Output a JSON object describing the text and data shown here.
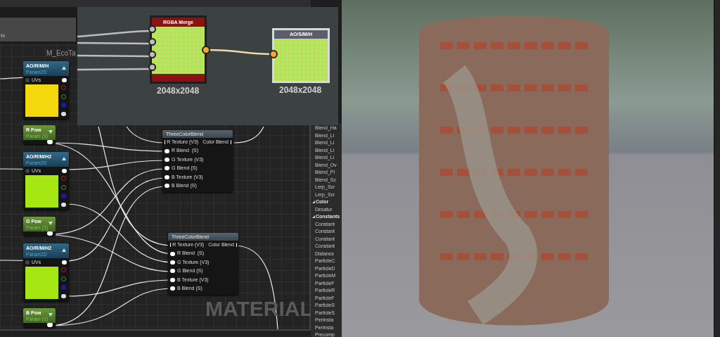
{
  "editor": {
    "tab_label": "ts",
    "material_name": "M_EcoTa",
    "graph_label": "MATERIAL"
  },
  "param_nodes": [
    {
      "kind": "texture",
      "title": "AO/R/M/H",
      "subtitle": "Param2D",
      "input": "UVs",
      "color": "#f2d80c"
    },
    {
      "kind": "scalar",
      "title": "R Pow",
      "subtitle": "Param (1)"
    },
    {
      "kind": "texture",
      "title": "AO/R/M/H2",
      "subtitle": "Param2D",
      "input": "UVs",
      "color": "#a6e612"
    },
    {
      "kind": "scalar",
      "title": "G Pow",
      "subtitle": "Param (1)"
    },
    {
      "kind": "texture",
      "title": "AO/R/M/H2",
      "subtitle": "Param2D",
      "input": "UVs",
      "color": "#a6e612"
    },
    {
      "kind": "scalar",
      "title": "B Pow",
      "subtitle": "Param (1)"
    }
  ],
  "blend_nodes": [
    {
      "title": "ThreeColorBlend",
      "output": "Color Blend",
      "inputs": [
        "R Texture (V3)",
        "R Blend  (S)",
        "G Texture (V3)",
        "G Blend (S)",
        "B Texture (V3)",
        "B Blend (S)"
      ]
    },
    {
      "title": "ThreeColorBlend",
      "output": "Color Blend",
      "inputs": [
        "R Texture (V3)",
        "R Blend  (S)",
        "G Texture (V3)",
        "G Blend (S)",
        "B Texture (V3)",
        "B Blend (S)"
      ]
    }
  ],
  "substance_graph": {
    "nodes": [
      {
        "kind": "merge",
        "title": "RGBA Merge",
        "resolution": "2048x2048"
      },
      {
        "kind": "output",
        "title": "AO/S/M/H",
        "resolution": "2048x2048"
      }
    ]
  },
  "palette": {
    "items": [
      {
        "kind": "item",
        "label": "Blend_Ha"
      },
      {
        "kind": "item",
        "label": "Blend_Li"
      },
      {
        "kind": "item",
        "label": "Blend_Li"
      },
      {
        "kind": "item",
        "label": "Blend_Li"
      },
      {
        "kind": "item",
        "label": "Blend_Li"
      },
      {
        "kind": "item",
        "label": "Blend_Ov"
      },
      {
        "kind": "item",
        "label": "Blend_Pi"
      },
      {
        "kind": "item",
        "label": "Blend_Sc"
      },
      {
        "kind": "item",
        "label": "Lerp_Scr"
      },
      {
        "kind": "item",
        "label": "Lerp_Scr"
      },
      {
        "kind": "category",
        "label": "Color",
        "expanded": true
      },
      {
        "kind": "item",
        "label": "Desatur"
      },
      {
        "kind": "category",
        "label": "Constants",
        "expanded": true
      },
      {
        "kind": "item",
        "label": "Constant"
      },
      {
        "kind": "item",
        "label": "Constant"
      },
      {
        "kind": "item",
        "label": "Constant"
      },
      {
        "kind": "item",
        "label": "Constant"
      },
      {
        "kind": "item",
        "label": "Distance"
      },
      {
        "kind": "item",
        "label": "ParticleC"
      },
      {
        "kind": "item",
        "label": "ParticleD"
      },
      {
        "kind": "item",
        "label": "ParticleM"
      },
      {
        "kind": "item",
        "label": "ParticleF"
      },
      {
        "kind": "item",
        "label": "ParticleR"
      },
      {
        "kind": "item",
        "label": "ParticleF"
      },
      {
        "kind": "item",
        "label": "ParticleS"
      },
      {
        "kind": "item",
        "label": "ParticleS"
      },
      {
        "kind": "item",
        "label": "PerInsta"
      },
      {
        "kind": "item",
        "label": "PerInsta"
      },
      {
        "kind": "item",
        "label": "Precomp"
      }
    ]
  }
}
